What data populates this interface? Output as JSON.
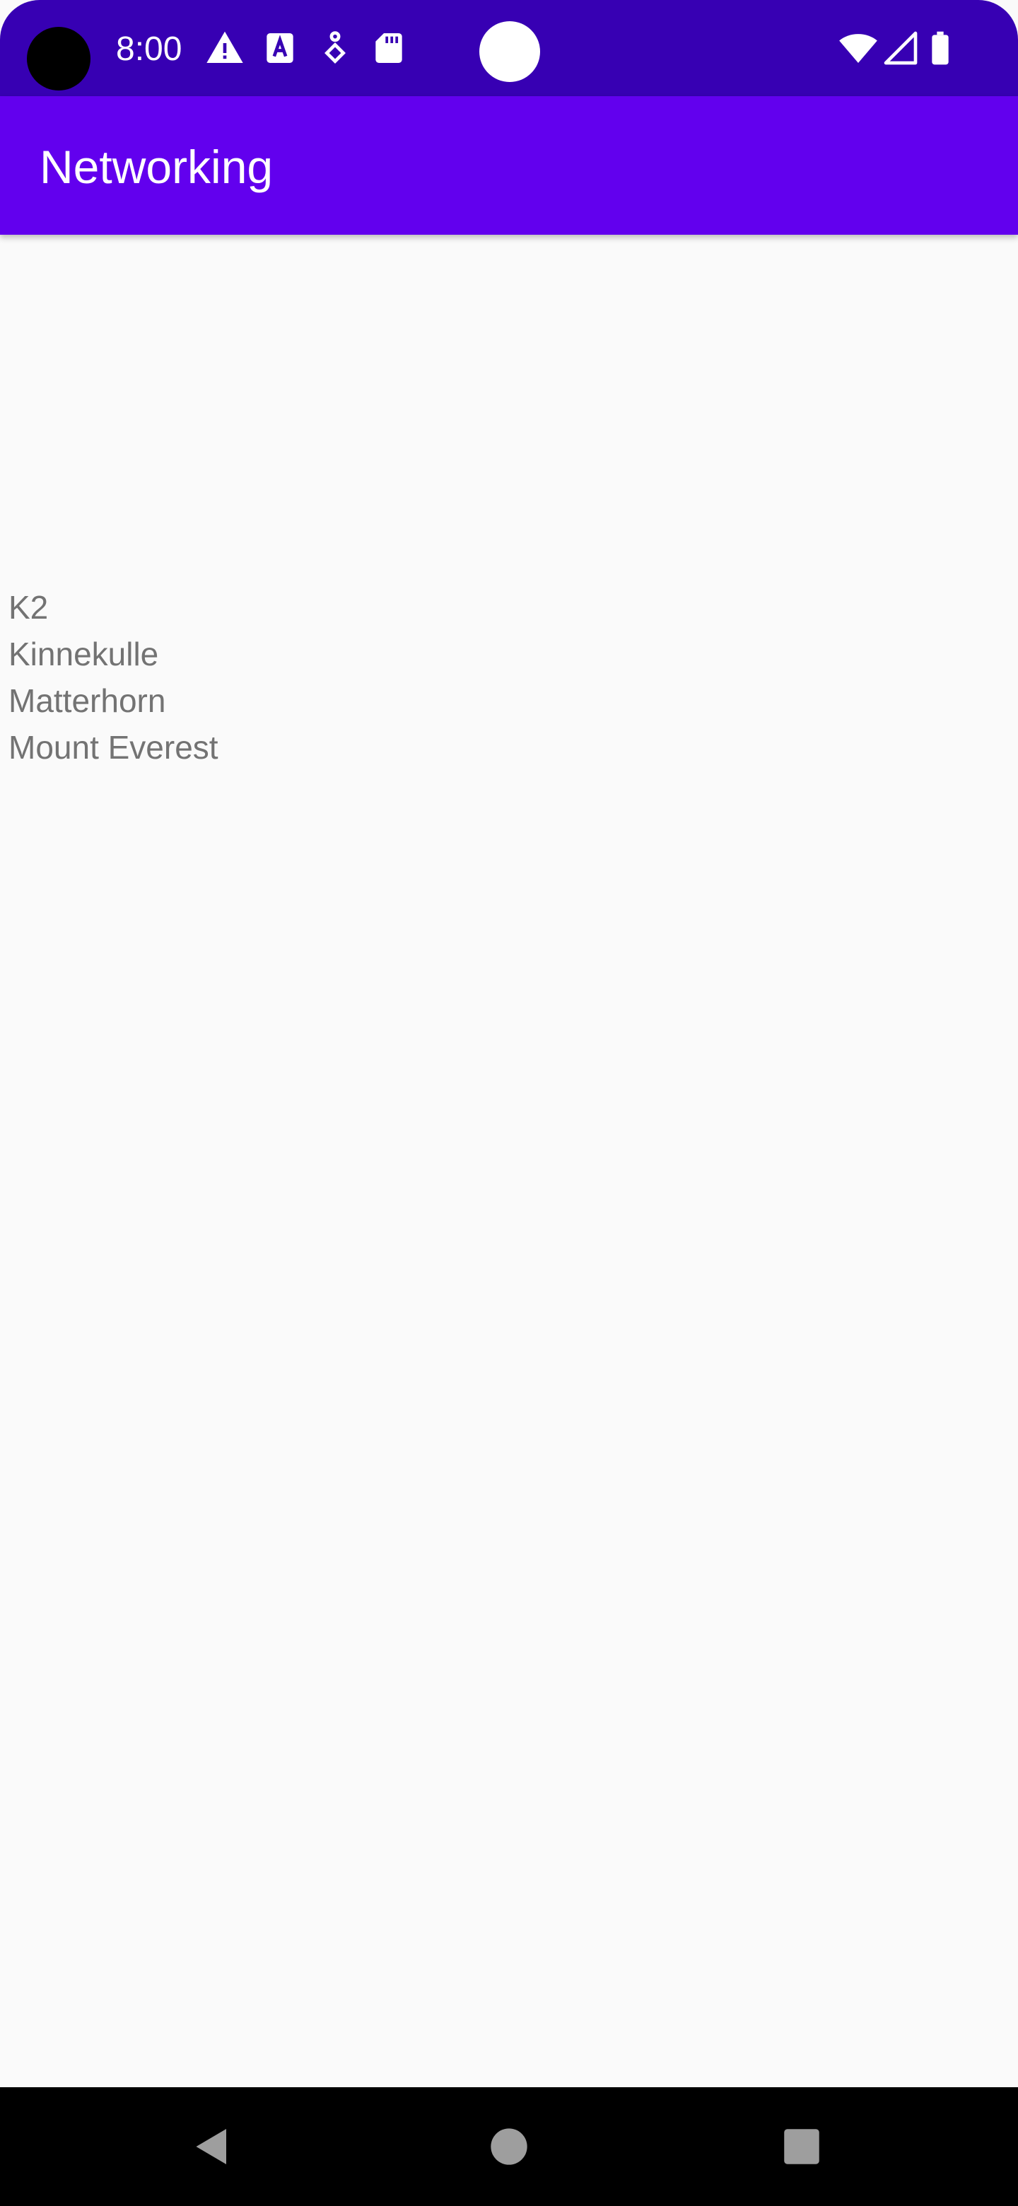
{
  "status_bar": {
    "time": "8:00",
    "left_icons": [
      "alert-icon",
      "text-a-icon",
      "accessibility-icon",
      "sd-card-icon"
    ],
    "right_icons": [
      "wifi-icon",
      "signal-icon",
      "battery-icon"
    ]
  },
  "app_bar": {
    "title": "Networking"
  },
  "mountains": {
    "items": [
      {
        "name": "K2"
      },
      {
        "name": "Kinnekulle"
      },
      {
        "name": "Matterhorn"
      },
      {
        "name": "Mount Everest"
      }
    ]
  },
  "nav_bar": {
    "buttons": [
      "back-icon",
      "home-icon",
      "recents-icon"
    ]
  },
  "colors": {
    "status_bar": "#3700b3",
    "app_bar": "#6200ee",
    "background": "#fafafa",
    "list_text": "#737373",
    "nav_bar": "#000000"
  }
}
